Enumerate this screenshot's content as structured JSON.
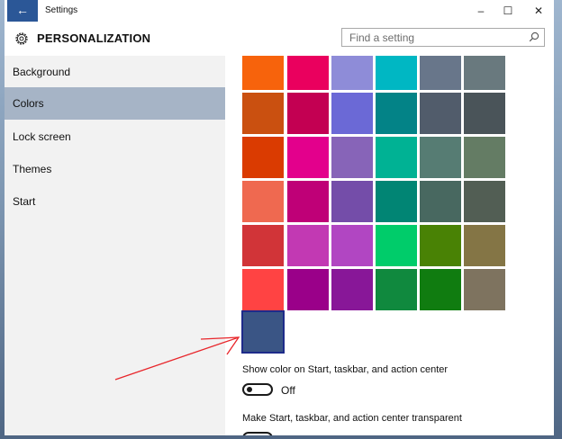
{
  "titlebar": {
    "app_title": "Settings",
    "back_icon": "←",
    "minimize_icon": "–",
    "maximize_icon": "☐",
    "close_icon": "✕"
  },
  "header": {
    "title": "PERSONALIZATION",
    "search_placeholder": "Find a setting"
  },
  "sidebar": {
    "items": [
      {
        "label": "Background",
        "active": false
      },
      {
        "label": "Colors",
        "active": true
      },
      {
        "label": "Lock screen",
        "active": false
      },
      {
        "label": "Themes",
        "active": false
      },
      {
        "label": "Start",
        "active": false
      }
    ]
  },
  "colors": {
    "swatch_rows": [
      [
        "#f7630c",
        "#ea005e",
        "#8e8cd8",
        "#00b7c3",
        "#68768a",
        "#69797e"
      ],
      [
        "#ca5010",
        "#c30052",
        "#6b69d6",
        "#038387",
        "#515c6b",
        "#4a5459"
      ],
      [
        "#da3b01",
        "#e3008c",
        "#8764b8",
        "#00b294",
        "#567c73",
        "#647c64"
      ],
      [
        "#ef6950",
        "#bf0077",
        "#744da9",
        "#018574",
        "#486860",
        "#525e54"
      ],
      [
        "#d13438",
        "#c239b3",
        "#b146c2",
        "#00cc6a",
        "#498205",
        "#847545"
      ],
      [
        "#ff4343",
        "#9a0089",
        "#881798",
        "#10893e",
        "#107c10",
        "#7e735f"
      ]
    ],
    "selected_color": "#3a5585"
  },
  "settings": {
    "show_color_label": "Show color on Start, taskbar, and action center",
    "show_color_state": "Off",
    "transparent_label": "Make Start, taskbar, and action center transparent"
  },
  "annotation": {
    "arrow_color": "#e8262b"
  }
}
